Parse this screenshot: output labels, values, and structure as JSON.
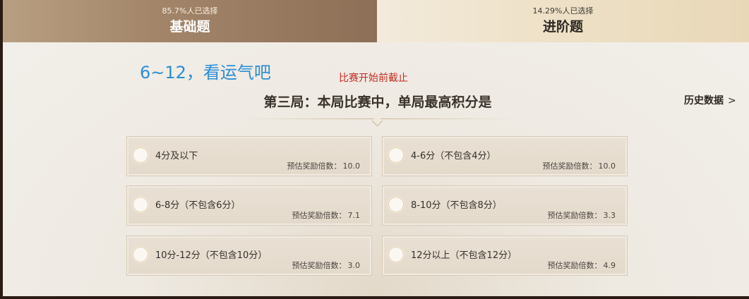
{
  "tabs": [
    {
      "percent": "85.7%人已选择",
      "title": "基础题",
      "active": true
    },
    {
      "percent": "14.29%人已选择",
      "title": "进阶题",
      "active": false
    }
  ],
  "annotations": {
    "blue_note": "6~12，看运气吧",
    "red_note": "比赛开始前截止"
  },
  "question": {
    "text": "第三局：本局比赛中，单局最高积分是"
  },
  "history": {
    "label": "历史数据",
    "arrow": ">"
  },
  "multiplier_label": "预估奖励倍数：",
  "options": [
    {
      "label": "4分及以下",
      "multiplier": "10.0"
    },
    {
      "label": "4-6分（不包含4分）",
      "multiplier": "10.0"
    },
    {
      "label": "6-8分（不包含6分）",
      "multiplier": "7.1"
    },
    {
      "label": "8-10分（不包含8分）",
      "multiplier": "3.3"
    },
    {
      "label": "10分-12分（不包含10分）",
      "multiplier": "3.0"
    },
    {
      "label": "12分以上（不包含12分）",
      "multiplier": "4.9"
    }
  ],
  "colors": {
    "annotation_blue": "#2a8ed6",
    "annotation_red": "#c42a1e",
    "active_tab": "#a3866a",
    "inactive_tab": "#efe2c9"
  }
}
